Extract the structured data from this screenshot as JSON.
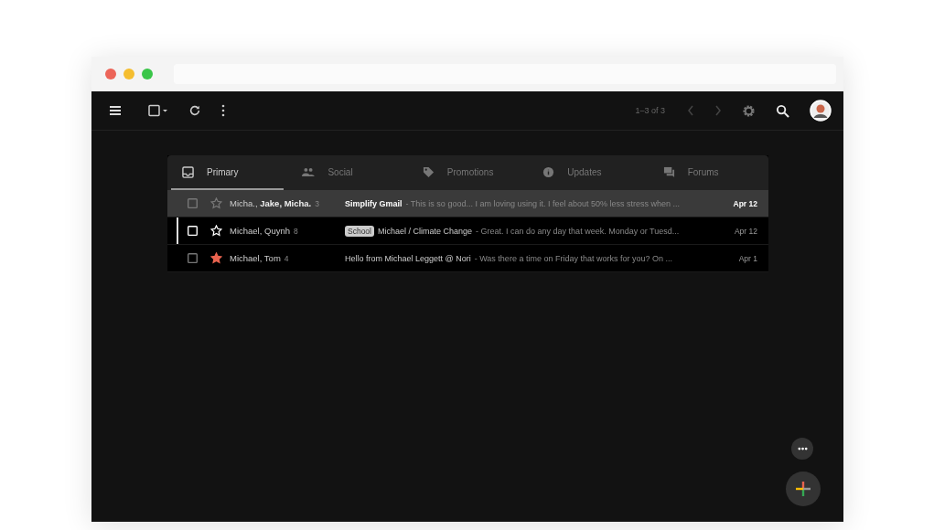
{
  "toolbar": {
    "page_range": "1–3 of 3"
  },
  "tabs": [
    {
      "label": "Primary",
      "kind": "inbox",
      "selected": true
    },
    {
      "label": "Social",
      "kind": "people",
      "selected": false
    },
    {
      "label": "Promotions",
      "kind": "tag",
      "selected": false
    },
    {
      "label": "Updates",
      "kind": "info",
      "selected": false
    },
    {
      "label": "Forums",
      "kind": "forum",
      "selected": false
    }
  ],
  "emails": [
    {
      "senders": "Micha., **Jake, Micha.**",
      "count": "3",
      "subject": "Simplify Gmail",
      "snippet": "- This is so good... I am loving using it. I feel about 50% less stress when ...",
      "date": "Apr 12",
      "unread": true,
      "starred": false,
      "highlighted": true,
      "focused": false
    },
    {
      "senders": "Michael, Quynh",
      "count": "8",
      "label": "School",
      "subject": "Michael / Climate Change",
      "snippet": "- Great. I can do any day that week. Monday or Tuesd...",
      "date": "Apr 12",
      "unread": false,
      "starred": false,
      "highlighted": false,
      "focused": true
    },
    {
      "senders": "Michael, Tom",
      "count": "4",
      "subject": "Hello from Michael Leggett @ Nori",
      "snippet": "- Was there a time on Friday that works for you? On ...",
      "date": "Apr 1",
      "unread": false,
      "starred": true,
      "highlighted": false,
      "focused": false
    }
  ]
}
